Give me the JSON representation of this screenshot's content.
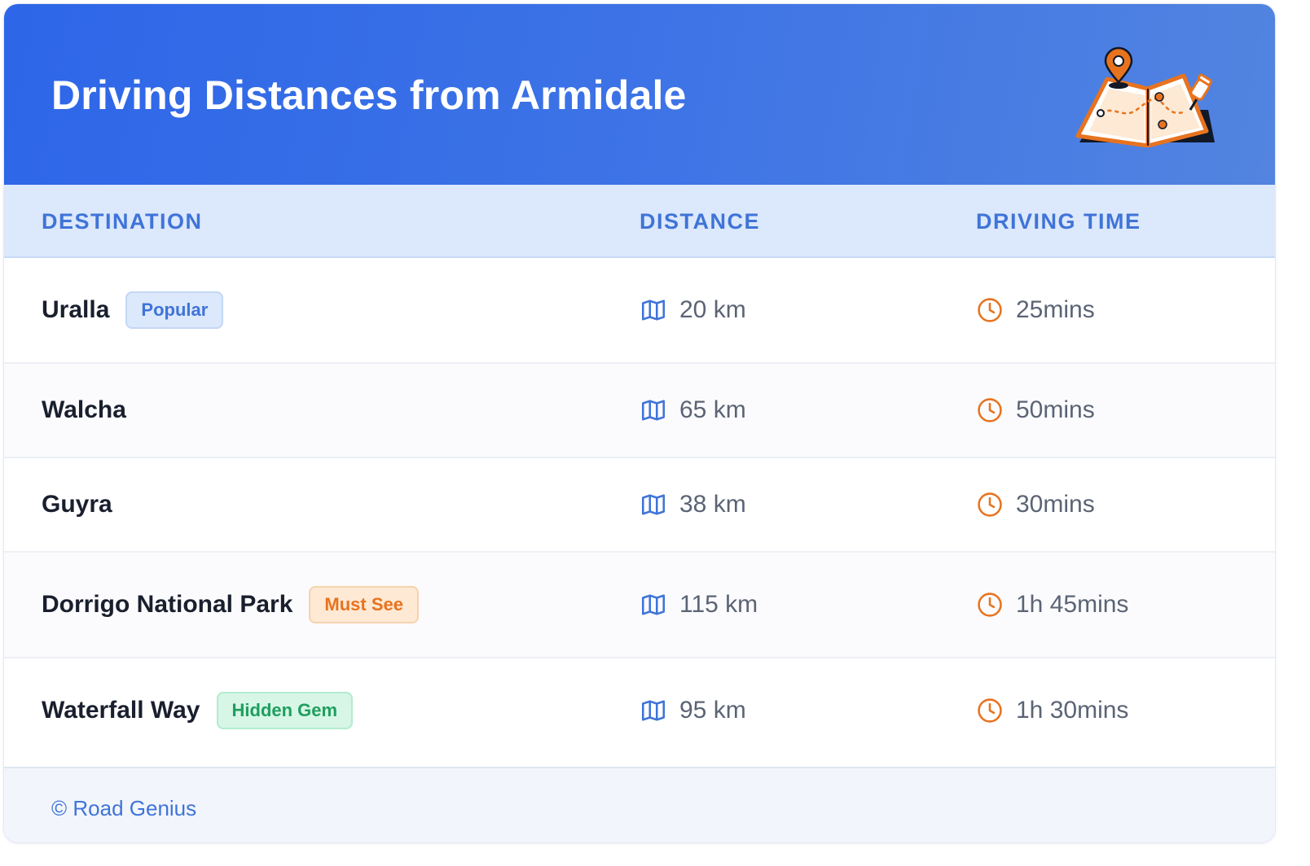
{
  "header": {
    "title": "Driving Distances from Armidale",
    "illustration_icon": "folded-map-with-pin-icon"
  },
  "table": {
    "columns": [
      "DESTINATION",
      "DISTANCE",
      "DRIVING TIME"
    ],
    "distance_icon": "map-icon",
    "time_icon": "clock-icon",
    "rows": [
      {
        "destination": "Uralla",
        "badge": "Popular",
        "badge_style": "blue",
        "distance": "20 km",
        "time": "25mins"
      },
      {
        "destination": "Walcha",
        "badge": "",
        "badge_style": "",
        "distance": "65 km",
        "time": "50mins"
      },
      {
        "destination": "Guyra",
        "badge": "",
        "badge_style": "",
        "distance": "38 km",
        "time": "30mins"
      },
      {
        "destination": "Dorrigo National Park",
        "badge": "Must See",
        "badge_style": "orange",
        "distance": "115 km",
        "time": "1h 45mins"
      },
      {
        "destination": "Waterfall Way",
        "badge": "Hidden Gem",
        "badge_style": "green",
        "distance": "95 km",
        "time": "1h 30mins"
      }
    ]
  },
  "footer": {
    "text": "© Road Genius"
  },
  "colors": {
    "header_gradient_start": "#2d66e8",
    "header_gradient_end": "#5284e0",
    "accent_blue": "#3f74d8",
    "accent_orange": "#e8731f",
    "accent_green": "#1f9e5e"
  }
}
